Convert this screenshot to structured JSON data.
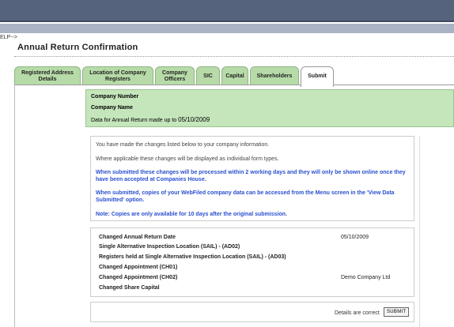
{
  "comment_text": "ELP-->",
  "page_title": "Annual Return Confirmation",
  "tabs": [
    {
      "label": "Registered Address Details"
    },
    {
      "label": "Location of Company Registers"
    },
    {
      "label": "Company Officers"
    },
    {
      "label": "SIC"
    },
    {
      "label": "Capital"
    },
    {
      "label": "Shareholders"
    },
    {
      "label": "Submit"
    }
  ],
  "company": {
    "number_label": "Company Number",
    "name_label": "Company Name",
    "madeup_label": "Data for Annual Return made up to",
    "madeup_date": "05/10/2009"
  },
  "messages": {
    "line1": "You have made the changes listed below to your company information.",
    "line2": "Where applicable these changes will be displayed as individual form types.",
    "line3": "When submitted these changes will be processed within 2 working days and they will only be shown online once they have been accepted at Companies House.",
    "line4": "When submitted, copies of your WebFiled company data can be accessed from the Menu screen in the 'View Data Submitted' option.",
    "line5": "Note: Copies are only available for 10 days after the original submission."
  },
  "changes": [
    {
      "label": "Changed Annual Return Date",
      "value": "05/10/2009"
    },
    {
      "label": "Single Alternative Inspection Location (SAIL) - (AD02)",
      "value": ""
    },
    {
      "label": "Registers held at Single Alternative Inspection Location (SAIL) - (AD03)",
      "value": ""
    },
    {
      "label": "Changed Appointment (CH01)",
      "value": ""
    },
    {
      "label": "Changed Appointment (CH02)",
      "value": "Demo Company Ltd"
    },
    {
      "label": "Changed Share Capital",
      "value": ""
    }
  ],
  "footer": {
    "correct_text": "Details are correct",
    "submit_label": "SUBMIT"
  }
}
